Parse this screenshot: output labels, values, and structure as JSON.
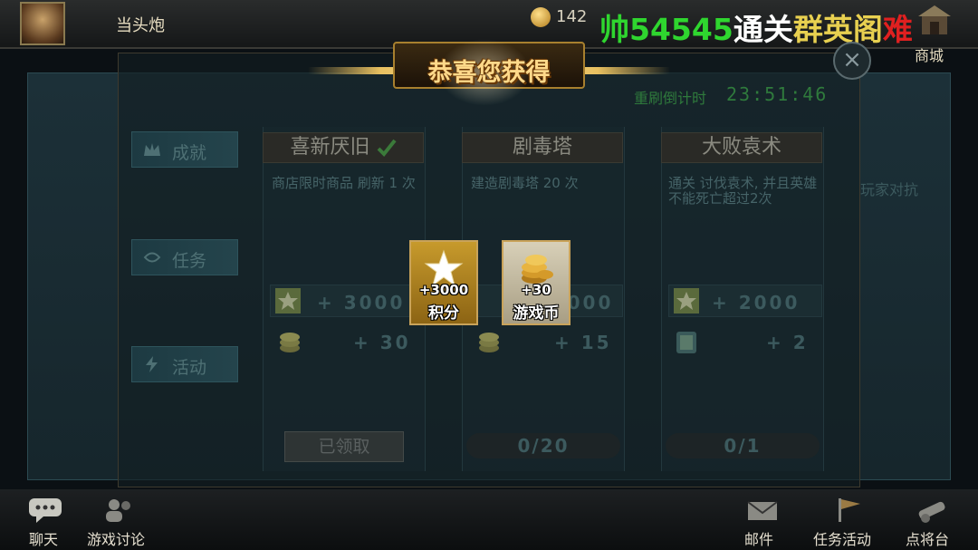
{
  "topbar": {
    "player_name": "当头炮",
    "coin_count": "142",
    "banner": {
      "part1": "帅54545",
      "part2": "通关",
      "part3": "群英阁",
      "part4": "难"
    },
    "shop_label": "商城"
  },
  "popup": {
    "title": "恭喜您获得",
    "rewards": [
      {
        "amount": "+3000",
        "name": "积分",
        "icon": "star-icon"
      },
      {
        "amount": "+30",
        "name": "游戏币",
        "icon": "gold-coins-icon"
      }
    ]
  },
  "panel": {
    "refresh_label": "重刷倒计时",
    "refresh_time": "23:51:46",
    "side_tabs": [
      {
        "label": "成就",
        "icon": "crown-icon"
      },
      {
        "label": "任务",
        "icon": "task-icon"
      },
      {
        "label": "活动",
        "icon": "lightning-icon"
      }
    ],
    "cards": [
      {
        "title": "喜新厌旧",
        "desc": "商店限时商品 刷新 1 次",
        "points": "+ 3000",
        "coins": "+ 30",
        "status": "已领取",
        "completed": true
      },
      {
        "title": "剧毒塔",
        "desc": "建造剧毒塔 20 次",
        "points": "+ 2000",
        "coins": "+ 15",
        "status": "0/20"
      },
      {
        "title": "大败袁术",
        "desc": "通关 讨伐袁术, 并且英雄不能死亡超过2次",
        "points": "+ 2000",
        "coins": "+ 2",
        "status": "0/1"
      }
    ],
    "right_partial": "玩家对抗"
  },
  "bottombar": {
    "items": [
      {
        "label": "聊天",
        "icon": "chat-icon"
      },
      {
        "label": "游戏讨论",
        "icon": "people-icon"
      },
      {
        "label": "邮件",
        "icon": "mail-icon"
      },
      {
        "label": "任务活动",
        "icon": "flag-icon"
      },
      {
        "label": "点将台",
        "icon": "cannon-icon"
      }
    ]
  },
  "colors": {
    "accent_gold": "#e8c060",
    "panel_bg": "#1c3038",
    "banner_green": "#2fd62f",
    "banner_red": "#e02020"
  }
}
